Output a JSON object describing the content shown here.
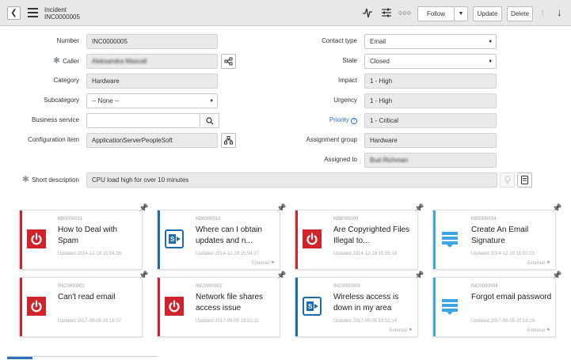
{
  "header": {
    "record_type": "Incident",
    "record_number": "INC0000005",
    "follow_label": "Follow",
    "update_label": "Update",
    "delete_label": "Delete"
  },
  "form": {
    "number": {
      "label": "Number",
      "value": "INC0000005"
    },
    "caller": {
      "label": "Caller",
      "value": "Aleksandra Mascall"
    },
    "category": {
      "label": "Category",
      "value": "Hardware"
    },
    "subcategory": {
      "label": "Subcategory",
      "value": "-- None --"
    },
    "business_service": {
      "label": "Business service",
      "value": ""
    },
    "configuration_item": {
      "label": "Configuration item",
      "value": "ApplicationServerPeopleSoft"
    },
    "contact_type": {
      "label": "Contact type",
      "value": "Email"
    },
    "state": {
      "label": "State",
      "value": "Closed"
    },
    "impact": {
      "label": "Impact",
      "value": "1 - High"
    },
    "urgency": {
      "label": "Urgency",
      "value": "1 - High"
    },
    "priority": {
      "label": "Priority",
      "value": "1 - Critical"
    },
    "assignment_group": {
      "label": "Assignment group",
      "value": "Hardware"
    },
    "assigned_to": {
      "label": "Assigned to",
      "value": "Bud Richman"
    },
    "short_description": {
      "label": "Short description",
      "value": "CPU load high for over 10 minutes"
    }
  },
  "cards": [
    {
      "number": "KB0000011",
      "title": "How to Deal with Spam",
      "updated": "Updated 2014-12-19 15:54:36",
      "external": "",
      "icon": "power-icon",
      "color": "#d0232c"
    },
    {
      "number": "KB0000012",
      "title": "Where can I obtain updates and n...",
      "updated": "Updated 2014-12-19 15:54:17",
      "external": "External",
      "icon": "sharepoint-icon",
      "color": "#1e6ab1"
    },
    {
      "number": "KB0000009",
      "title": "Are Copyrighted Files Illegal to...",
      "updated": "Updated 2014-12-19 15:55:18",
      "external": "",
      "icon": "power-icon",
      "color": "#d0232c"
    },
    {
      "number": "KB0000024",
      "title": "Create An Email Signature",
      "updated": "Updated 2014-12-19 15:50:23",
      "external": "External",
      "icon": "stack-icon",
      "color": "#3fa4e2"
    },
    {
      "number": "INC0000001",
      "title": "Can't read email",
      "updated": "Updated 2017-09-05 20:16:07",
      "external": "",
      "icon": "power-icon",
      "color": "#d0232c"
    },
    {
      "number": "INC0000002",
      "title": "Network file shares access issue",
      "updated": "Updated 2017-09-05 19:51:11",
      "external": "",
      "icon": "power-icon",
      "color": "#d0232c"
    },
    {
      "number": "INC0000003",
      "title": "Wireless access is down in my area",
      "updated": "Updated 2017-09-05 19:51:14",
      "external": "External",
      "icon": "sharepoint-icon",
      "color": "#1e6ab1"
    },
    {
      "number": "INC0000004",
      "title": "Forgot email password",
      "updated": "Updated 2017-09-05 20:18:24",
      "external": "External",
      "icon": "stack-icon",
      "color": "#3fa4e2"
    }
  ]
}
